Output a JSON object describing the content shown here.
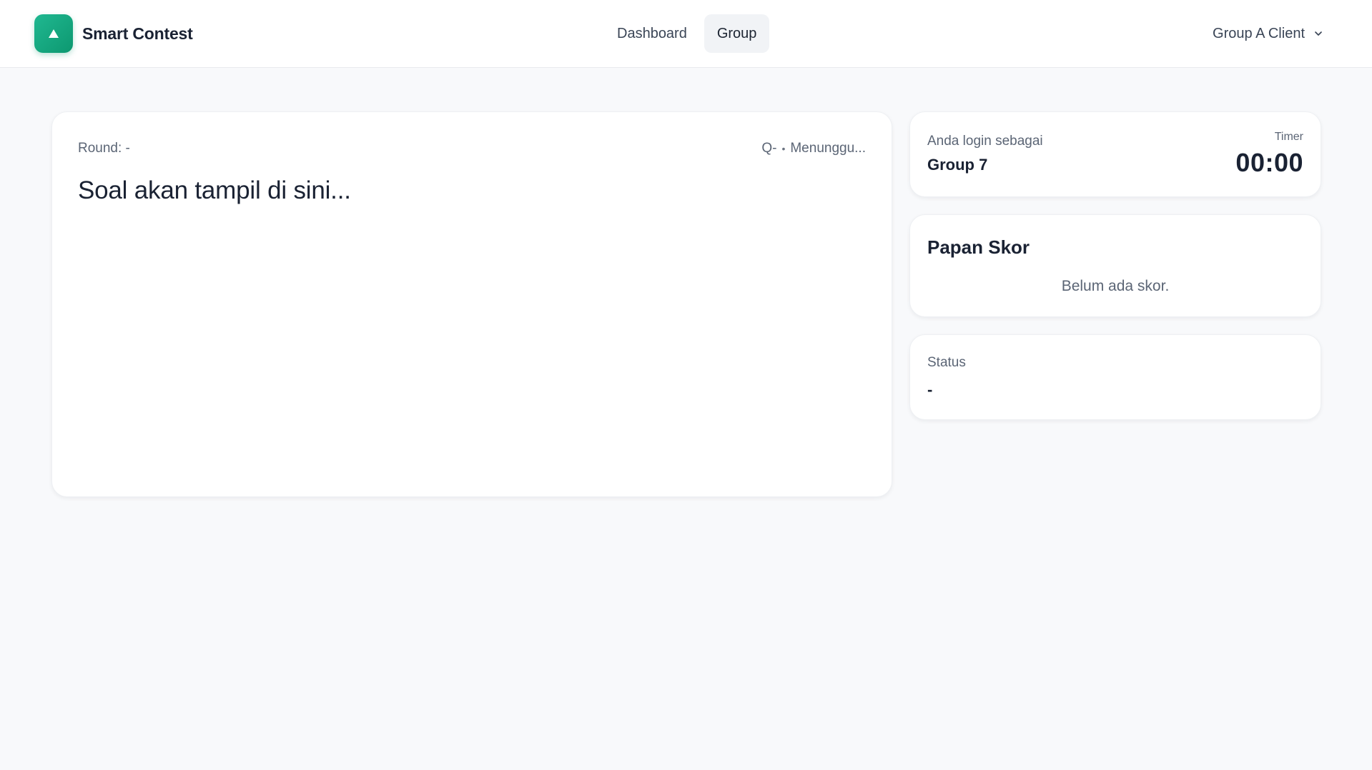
{
  "app": {
    "name": "Smart Contest",
    "logo_icon": "triangle-up-icon",
    "brand_color": "#14a883"
  },
  "nav": {
    "items": [
      {
        "label": "Dashboard",
        "active": false
      },
      {
        "label": "Group",
        "active": true
      }
    ]
  },
  "user_menu": {
    "label": "Group A Client",
    "icon": "chevron-down-icon"
  },
  "question": {
    "round_label": "Round: -",
    "question_number": "Q-",
    "status": "Menunggu...",
    "text": "Soal akan tampil di sini..."
  },
  "login": {
    "label": "Anda login sebagai",
    "group": "Group 7"
  },
  "timer": {
    "label": "Timer",
    "value": "00:00"
  },
  "scoreboard": {
    "title": "Papan Skor",
    "empty_text": "Belum ada skor."
  },
  "status": {
    "label": "Status",
    "value": "-"
  }
}
